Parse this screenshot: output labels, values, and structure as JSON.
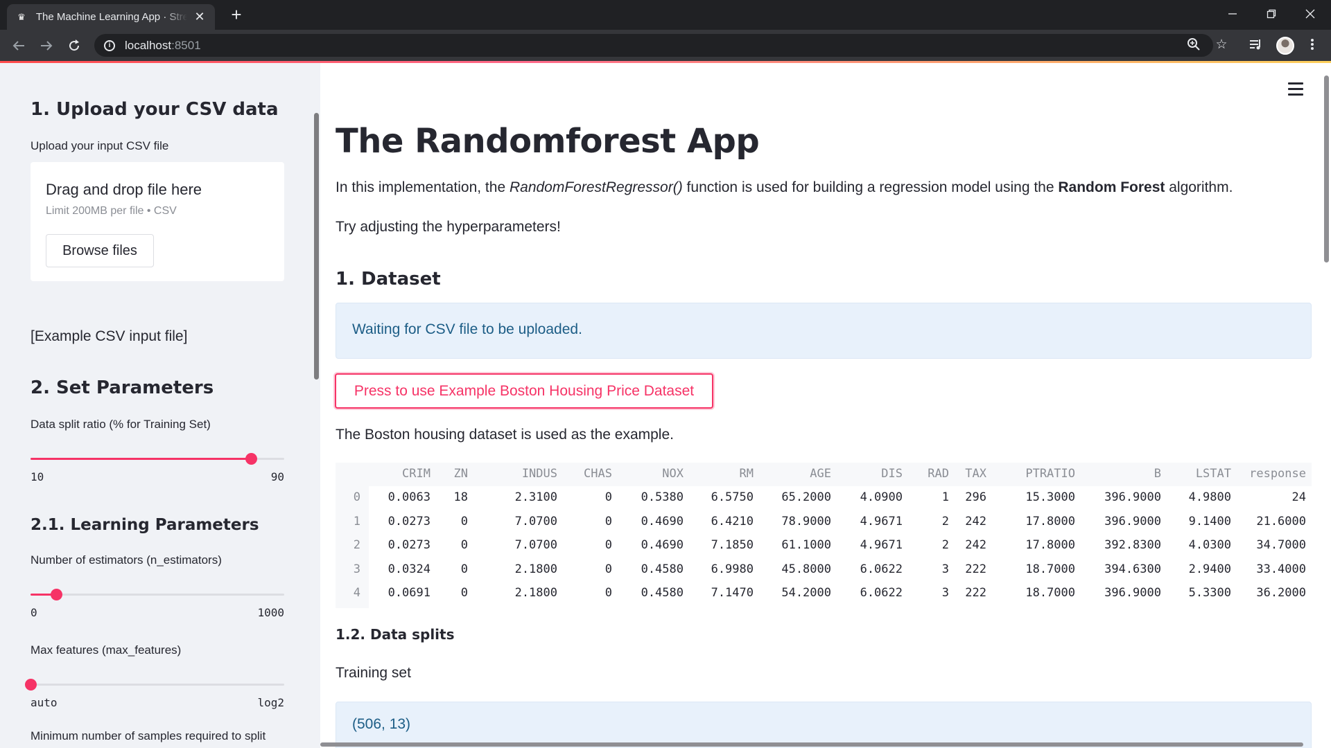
{
  "browser": {
    "tab_title": "The Machine Learning App · Streamlit",
    "url_host": "localhost",
    "url_port": ":8501",
    "new_tab_label": "+",
    "close_tab_label": "✕"
  },
  "sidebar": {
    "upload_heading": "1. Upload your CSV data",
    "upload_label": "Upload your input CSV file",
    "dropzone_title": "Drag and drop file here",
    "dropzone_limit": "Limit 200MB per file • CSV",
    "browse_label": "Browse files",
    "example_link": "[Example CSV input file]",
    "params_heading": "2. Set Parameters",
    "split": {
      "label": "Data split ratio (% for Training Set)",
      "min": "10",
      "max": "90",
      "value_fraction": 0.87
    },
    "learning_heading": "2.1. Learning Parameters",
    "estimators": {
      "label": "Number of estimators (n_estimators)",
      "min": "0",
      "max": "1000",
      "value_fraction": 0.1
    },
    "max_features": {
      "label": "Max features (max_features)",
      "min": "auto",
      "max": "log2",
      "value_fraction": 0.0
    },
    "min_samples_label": "Minimum number of samples required to split"
  },
  "main": {
    "title": "The Randomforest App",
    "intro_prefix": "In this implementation, the ",
    "intro_function": "RandomForestRegressor()",
    "intro_middle": " function is used for building a regression model using the ",
    "intro_bold": "Random Forest",
    "intro_suffix": " algorithm.",
    "try_text": "Try adjusting the hyperparameters!",
    "dataset_heading": "1. Dataset",
    "waiting_text": "Waiting for CSV file to be uploaded.",
    "example_button": "Press to use Example Boston Housing Price Dataset",
    "boston_text": "The Boston housing dataset is used as the example.",
    "splits_heading": "1.2. Data splits",
    "training_label": "Training set",
    "training_shape": "(506, 13)"
  },
  "table": {
    "columns": [
      "CRIM",
      "ZN",
      "INDUS",
      "CHAS",
      "NOX",
      "RM",
      "AGE",
      "DIS",
      "RAD",
      "TAX",
      "PTRATIO",
      "B",
      "LSTAT",
      "response"
    ],
    "rows": [
      {
        "index": "0",
        "values": [
          "0.0063",
          "18",
          "2.3100",
          "0",
          "0.5380",
          "6.5750",
          "65.2000",
          "4.0900",
          "1",
          "296",
          "15.3000",
          "396.9000",
          "4.9800",
          "24"
        ]
      },
      {
        "index": "1",
        "values": [
          "0.0273",
          "0",
          "7.0700",
          "0",
          "0.4690",
          "6.4210",
          "78.9000",
          "4.9671",
          "2",
          "242",
          "17.8000",
          "396.9000",
          "9.1400",
          "21.6000"
        ]
      },
      {
        "index": "2",
        "values": [
          "0.0273",
          "0",
          "7.0700",
          "0",
          "0.4690",
          "7.1850",
          "61.1000",
          "4.9671",
          "2",
          "242",
          "17.8000",
          "392.8300",
          "4.0300",
          "34.7000"
        ]
      },
      {
        "index": "3",
        "values": [
          "0.0324",
          "0",
          "2.1800",
          "0",
          "0.4580",
          "6.9980",
          "45.8000",
          "6.0622",
          "3",
          "222",
          "18.7000",
          "394.6300",
          "2.9400",
          "33.4000"
        ]
      },
      {
        "index": "4",
        "values": [
          "0.0691",
          "0",
          "2.1800",
          "0",
          "0.4580",
          "7.1470",
          "54.2000",
          "6.0622",
          "3",
          "222",
          "18.7000",
          "396.9000",
          "5.3300",
          "36.2000"
        ]
      }
    ]
  },
  "colors": {
    "accent": "#f63366",
    "sidebar_bg": "#f0f2f6",
    "info_bg": "#e8f1fb",
    "info_text": "#1c5d86"
  },
  "icons": [
    "streamlit-crown-icon",
    "back-icon",
    "forward-icon",
    "reload-icon",
    "info-icon",
    "zoom-icon",
    "star-icon",
    "media-icon",
    "kebab-menu-icon",
    "hamburger-menu-icon"
  ]
}
